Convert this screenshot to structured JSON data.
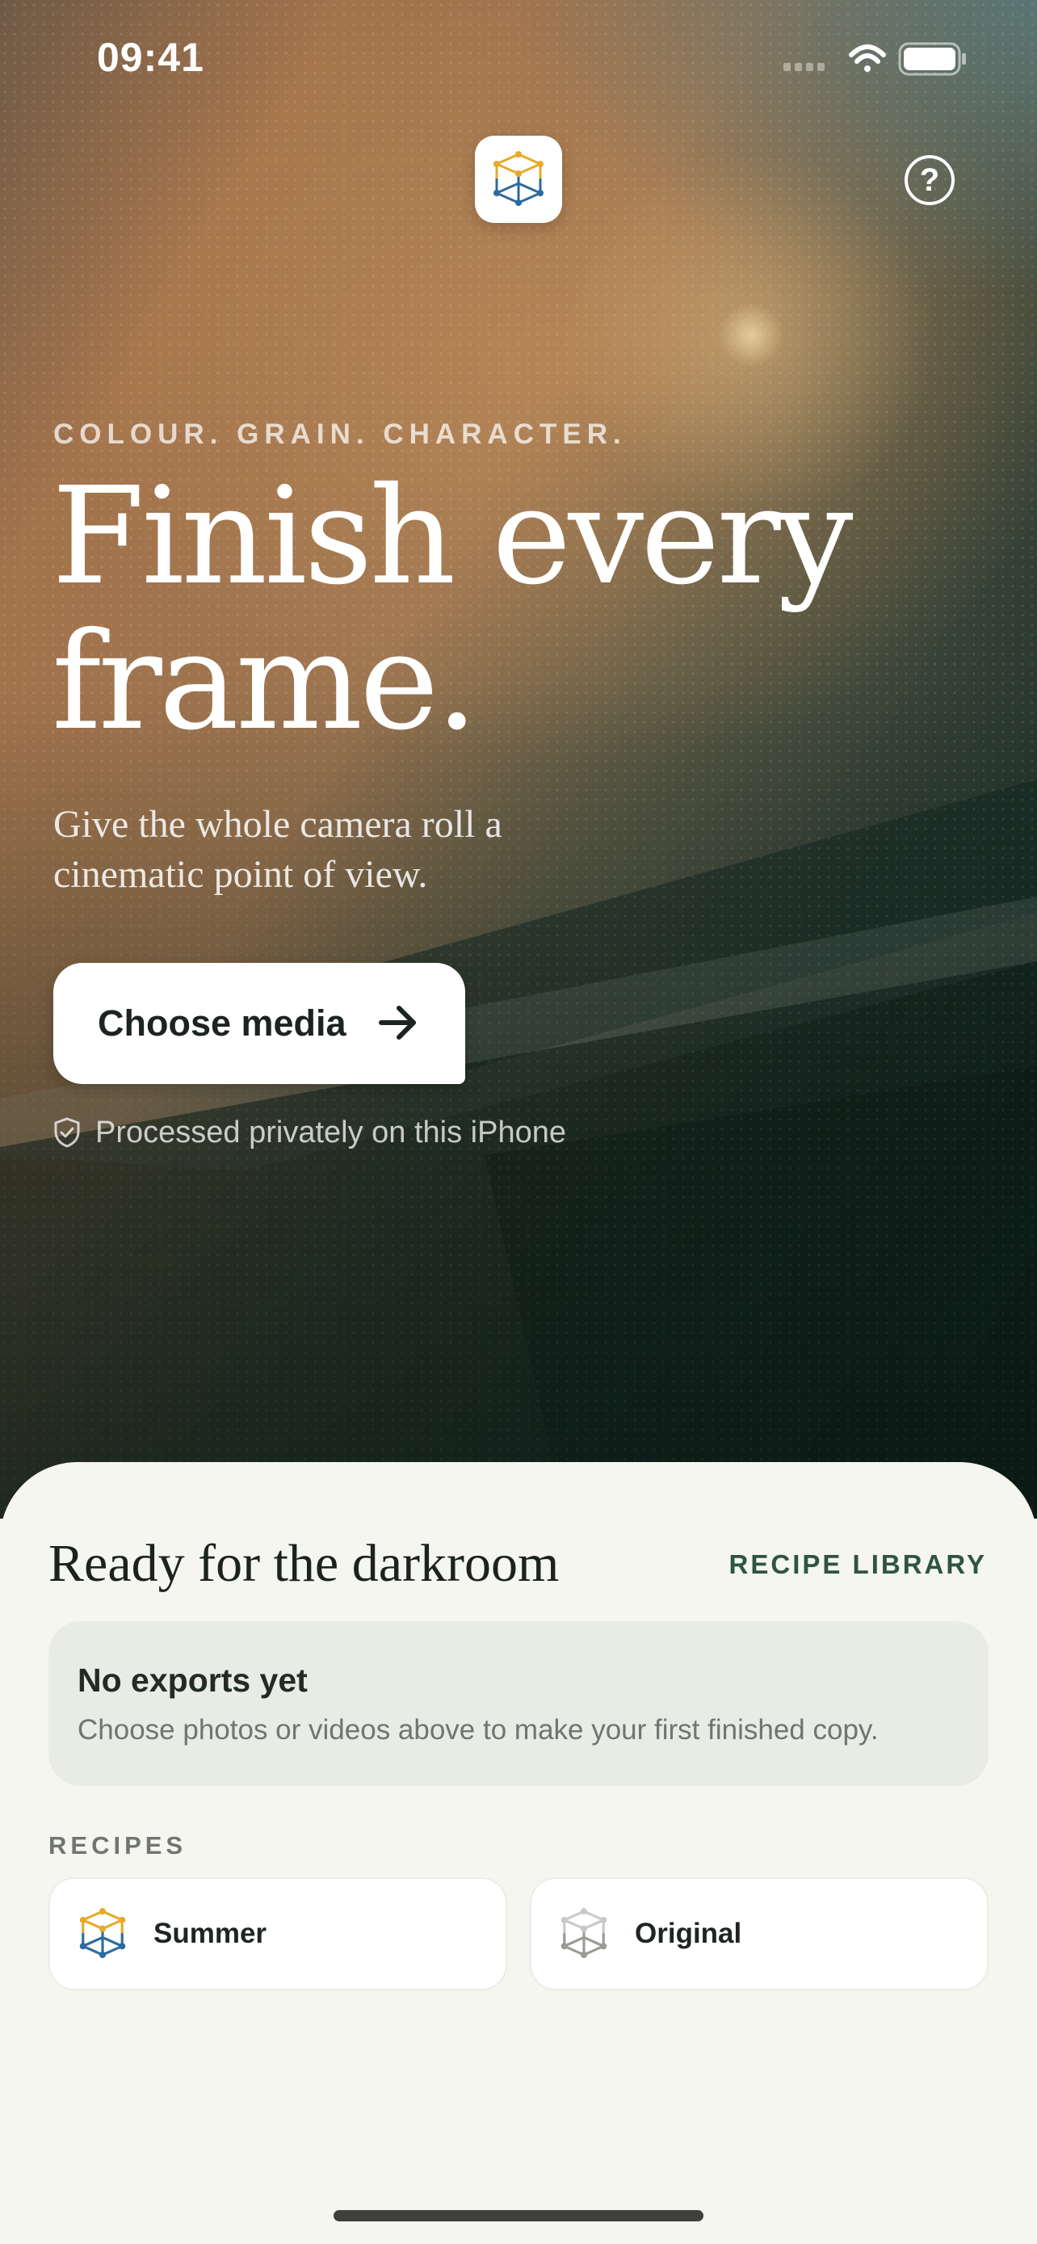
{
  "status_bar": {
    "time": "09:41",
    "icons": [
      "cellular-icon",
      "wifi-icon",
      "battery-icon"
    ]
  },
  "header": {
    "logo_icon": "cube-logo-icon",
    "help_icon": "question-circle-icon",
    "help_glyph": "?"
  },
  "hero": {
    "eyebrow": "COLOUR. GRAIN. CHARACTER.",
    "headline_line1": "Finish every",
    "headline_line2": "frame.",
    "subcopy_line1": "Give the whole camera roll a",
    "subcopy_line2": "cinematic point of view.",
    "cta_label": "Choose media",
    "cta_icon": "arrow-right-icon",
    "privacy_text": "Processed privately on this iPhone",
    "privacy_icon": "shield-check-icon"
  },
  "sheet": {
    "title": "Ready for the darkroom",
    "recipe_library_label": "RECIPE LIBRARY",
    "empty_state": {
      "title": "No exports yet",
      "text": "Choose photos or videos above to make your first finished copy."
    },
    "recipes_label": "RECIPES",
    "recipes": [
      {
        "name": "Summer",
        "icon": "cube-color-icon"
      },
      {
        "name": "Original",
        "icon": "cube-gray-icon"
      }
    ]
  },
  "colors": {
    "accent_green": "#2e5541",
    "sheet_bg": "#f6f6f1",
    "card_bg": "#e9ebe5",
    "logo_yellow": "#e8a92a",
    "logo_blue": "#2c6aa0"
  }
}
